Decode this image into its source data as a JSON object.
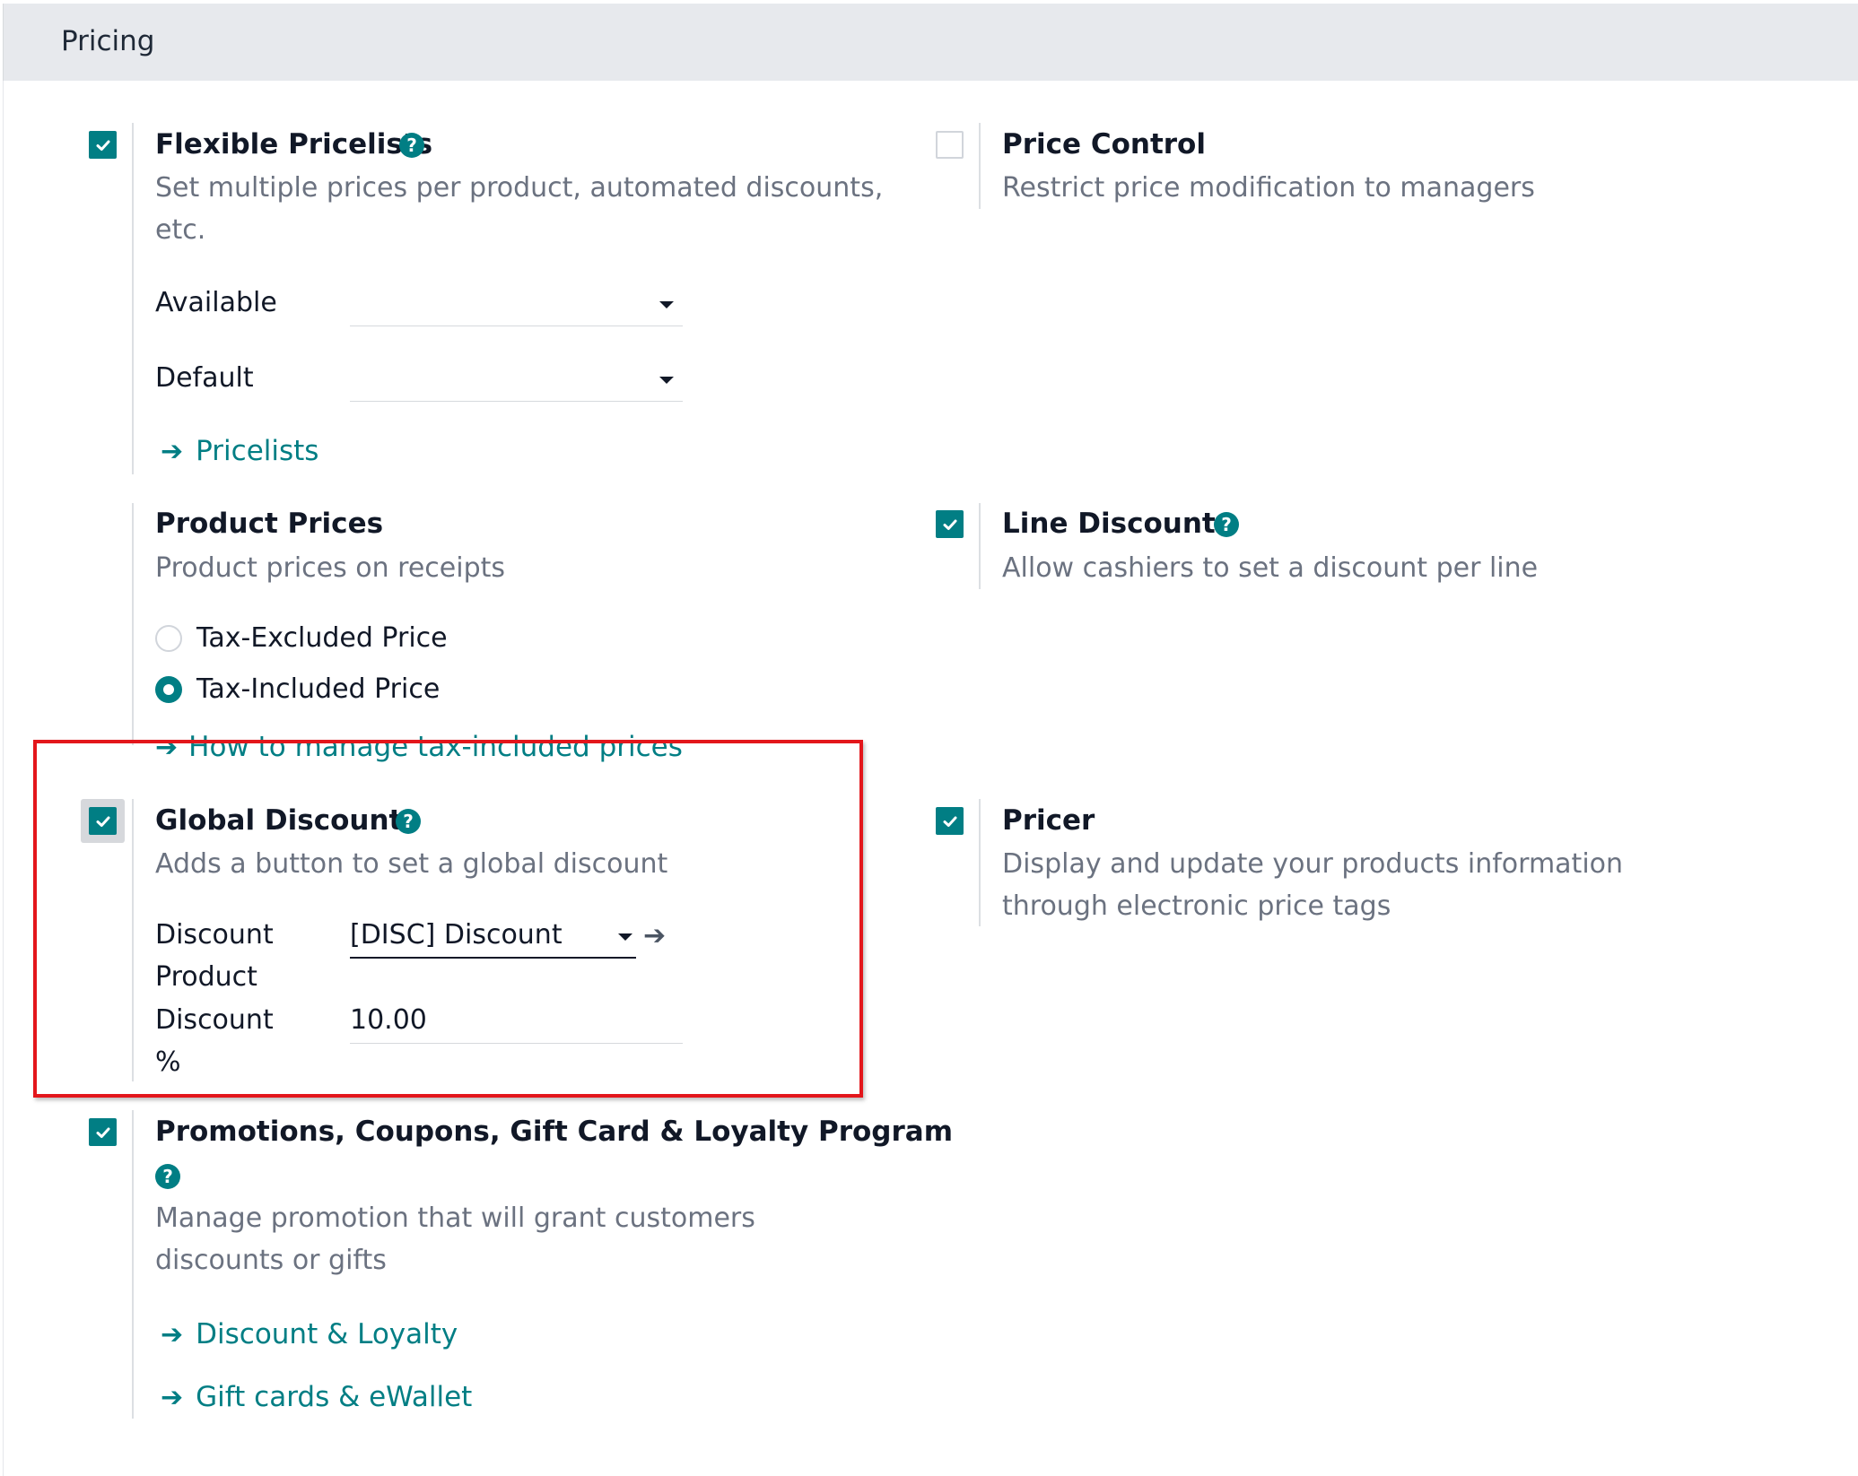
{
  "section": {
    "title": "Pricing"
  },
  "flexible_pricelists": {
    "checked": true,
    "title": "Flexible Pricelists",
    "description": "Set multiple prices per product, automated discounts, etc.",
    "available_label": "Available",
    "available_value": "",
    "default_label": "Default",
    "default_value": "",
    "link": "Pricelists"
  },
  "price_control": {
    "checked": false,
    "title": "Price Control",
    "description": "Restrict price modification to managers"
  },
  "product_prices": {
    "title": "Product Prices",
    "description": "Product prices on receipts",
    "options": [
      {
        "label": "Tax-Excluded Price",
        "selected": false
      },
      {
        "label": "Tax-Included Price",
        "selected": true
      }
    ],
    "link": "How to manage tax-included prices"
  },
  "line_discounts": {
    "checked": true,
    "title": "Line Discounts",
    "description": "Allow cashiers to set a discount per line"
  },
  "global_discounts": {
    "checked": true,
    "title": "Global Discounts",
    "description": "Adds a button to set a global discount",
    "product_label_1": "Discount",
    "product_label_2": "Product",
    "product_value": "[DISC] Discount",
    "percent_label_1": "Discount",
    "percent_label_2": "%",
    "percent_value": "10.00"
  },
  "pricer": {
    "checked": true,
    "title": "Pricer",
    "description_1": "Display and update your products information",
    "description_2": "through electronic price tags"
  },
  "promotions": {
    "checked": true,
    "title": "Promotions, Coupons, Gift Card & Loyalty Program",
    "description_1": "Manage promotion that will grant customers",
    "description_2": "discounts or gifts",
    "links": [
      "Discount & Loyalty",
      "Gift cards & eWallet"
    ]
  },
  "colors": {
    "accent": "#017e84",
    "highlight": "#e3161b",
    "header_bg": "#e7e9ed"
  }
}
